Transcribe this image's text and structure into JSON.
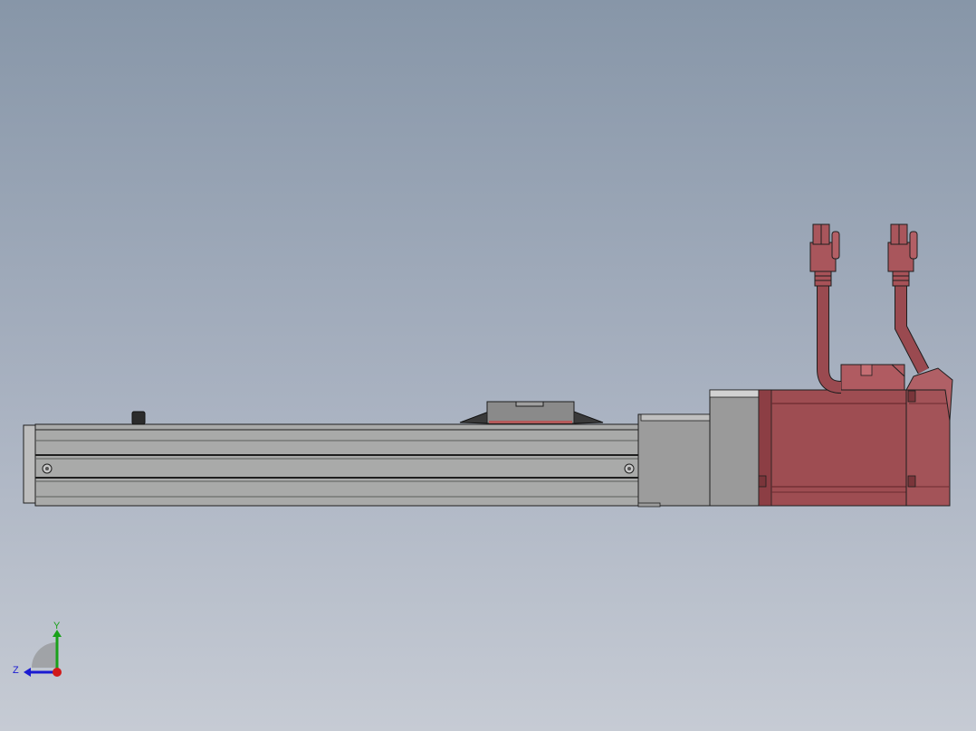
{
  "viewport": {
    "view": "side-elevation",
    "background_top": "#8796a8",
    "background_bottom": "#c6cbd4"
  },
  "model": {
    "name": "linear-actuator-with-servo-motor",
    "colors": {
      "rail": "#a9aaa9",
      "rail_dark": "#5c5d5c",
      "carriage": "#8a8a8a",
      "adapter": "#9c9c9c",
      "motor": "#9e4d52",
      "motor_dark": "#6b2b30",
      "cable": "#9a4a50",
      "outline": "#1e1e1e"
    }
  },
  "triad": {
    "y_label": "Y",
    "z_label": "Z",
    "x_color": "#d11a1a",
    "y_color": "#1aa11a",
    "z_color": "#1a1ad1"
  }
}
